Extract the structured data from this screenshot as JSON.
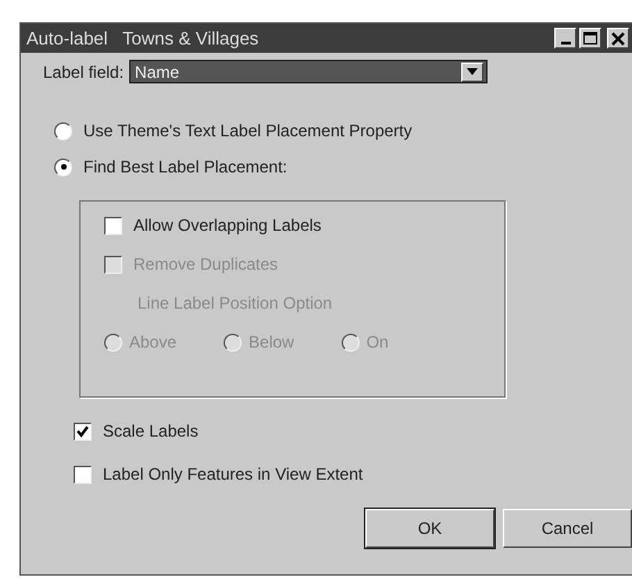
{
  "window": {
    "title": "Auto-label   Towns & Villages"
  },
  "label_field": {
    "label": "Label field:",
    "value": "Name"
  },
  "placement_options": [
    {
      "label": "Use Theme's Text Label Placement Property",
      "selected": false
    },
    {
      "label": "Find Best Label Placement:",
      "selected": true
    }
  ],
  "group": {
    "checkboxes": [
      {
        "label": "Allow Overlapping Labels",
        "checked": false,
        "disabled": false
      },
      {
        "label": "Remove Duplicates",
        "checked": false,
        "disabled": true
      }
    ],
    "line_label_position": {
      "label": "Line Label Position Option",
      "disabled": true,
      "options": [
        {
          "label": "Above",
          "selected": false
        },
        {
          "label": "Below",
          "selected": false
        },
        {
          "label": "On",
          "selected": false
        }
      ]
    }
  },
  "options": [
    {
      "label": "Scale Labels",
      "checked": true
    },
    {
      "label": "Label Only Features in View Extent",
      "checked": false
    }
  ],
  "buttons": [
    {
      "label": "OK",
      "default": true
    },
    {
      "label": "Cancel",
      "default": false
    }
  ]
}
